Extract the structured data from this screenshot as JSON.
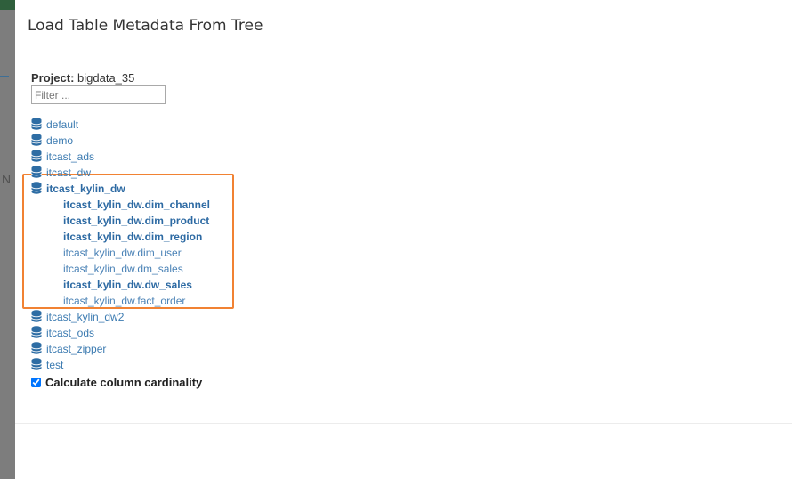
{
  "modal": {
    "title": "Load Table Metadata From Tree"
  },
  "project": {
    "label": "Project:",
    "name": "bigdata_35"
  },
  "filter": {
    "placeholder": "Filter ...",
    "value": ""
  },
  "tree": {
    "databases_before": [
      "default",
      "demo",
      "itcast_ads",
      "itcast_dw"
    ],
    "expanded_database": "itcast_kylin_dw",
    "tables": [
      {
        "name": "itcast_kylin_dw.dim_channel",
        "selected": true
      },
      {
        "name": "itcast_kylin_dw.dim_product",
        "selected": true
      },
      {
        "name": "itcast_kylin_dw.dim_region",
        "selected": true
      },
      {
        "name": "itcast_kylin_dw.dim_user",
        "selected": false
      },
      {
        "name": "itcast_kylin_dw.dm_sales",
        "selected": false
      },
      {
        "name": "itcast_kylin_dw.dw_sales",
        "selected": true
      },
      {
        "name": "itcast_kylin_dw.fact_order",
        "selected": false
      }
    ],
    "databases_after": [
      "itcast_kylin_dw2",
      "itcast_ods",
      "itcast_zipper",
      "test"
    ]
  },
  "options": {
    "calculate_cardinality_label": "Calculate column cardinality",
    "calculate_cardinality_checked": true
  },
  "backdrop": {
    "partial_letter": "N"
  },
  "colors": {
    "link": "#3c7bb1",
    "highlight_border": "#f18233",
    "icon": "#2e6da4"
  }
}
